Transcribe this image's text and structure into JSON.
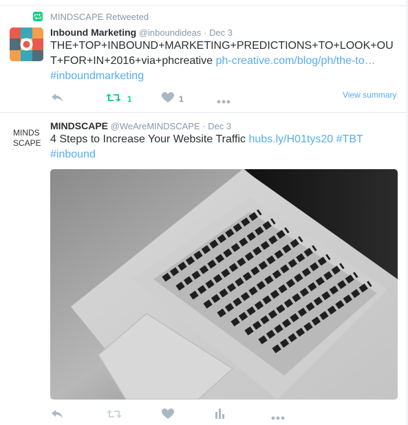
{
  "tweet1": {
    "retweet_context": "MINDSCAPE Retweeted",
    "author_name": "Inbound Marketing",
    "handle": "@inboundideas",
    "separator": "·",
    "date": "Dec 3",
    "text_line1": "THE+TOP+INBOUND+MARKETING+PREDICTIONS+TO+LOOK+OU",
    "text_line2_prefix": "T+FOR+IN+2016+via+phcreative",
    "link": "ph-creative.com/blog/ph/the-to…",
    "hashtag": "#inboundmarketing",
    "retweet_count": "1",
    "like_count": "1",
    "view_summary": "View summary",
    "colors": {
      "retweet_active": "#19cf86",
      "icon_gray": "#aab8c2"
    }
  },
  "tweet2": {
    "avatar_text_1": "MINDS",
    "avatar_text_2": "SCAPE",
    "author_name": "MINDSCAPE",
    "handle": "@WeAreMINDSCAPE",
    "separator": "·",
    "date": "Dec 3",
    "text_prefix": "4 Steps to Increase Your Website Traffic",
    "link": "hubs.ly/H01tys20",
    "hashtag_tbt": "#TBT",
    "hashtag_inbound": "#inbound"
  },
  "icons": [
    "retweet-icon",
    "reply-icon",
    "retweet-icon",
    "like-icon",
    "more-icon",
    "analytics-icon"
  ]
}
